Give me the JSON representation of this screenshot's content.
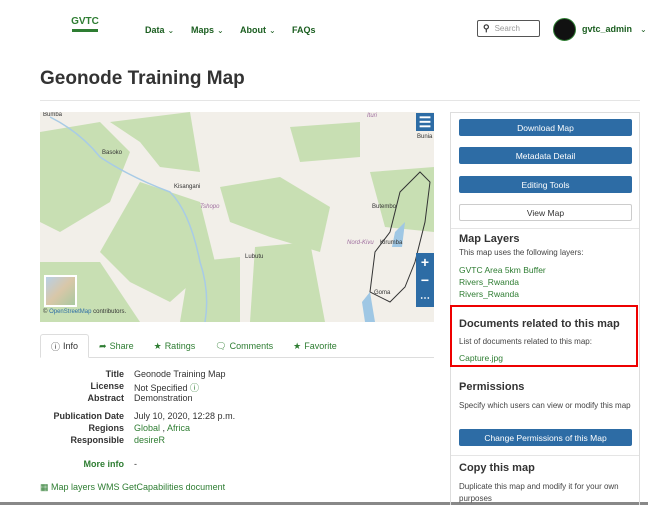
{
  "header": {
    "logo_text": "GVTC",
    "nav": [
      {
        "label": "Data"
      },
      {
        "label": "Maps"
      },
      {
        "label": "About"
      },
      {
        "label": "FAQs"
      }
    ],
    "search_placeholder": "Search",
    "user": "gvtc_admin"
  },
  "page_title": "Geonode Training Map",
  "map": {
    "labels": {
      "bumba": "Bumba",
      "basoko": "Basoko",
      "kisangani": "Kisangani",
      "tshopo": "Tshopo",
      "lubutu": "Lubutu",
      "ituri": "Ituri",
      "bunia": "Bunia",
      "butembo": "Butembo",
      "nordkivu": "Nord-Kivu",
      "kirumba": "Kirumba",
      "goma": "Goma"
    },
    "attribution_link": "OpenStreetMap",
    "attribution_rest": " contributors.",
    "attribution_prefix": "© "
  },
  "tabs": [
    {
      "label": "Info"
    },
    {
      "label": "Share"
    },
    {
      "label": "Ratings"
    },
    {
      "label": "Comments"
    },
    {
      "label": "Favorite"
    }
  ],
  "info": {
    "title_k": "Title",
    "title_v": "Geonode Training Map",
    "license_k": "License",
    "license_v": "Not Specified",
    "abstract_k": "Abstract",
    "abstract_v": "Demonstration",
    "pub_k": "Publication Date",
    "pub_v": "July 10, 2020, 12:28 p.m.",
    "regions_k": "Regions",
    "region1": "Global",
    "region_sep": " , ",
    "region2": "Africa",
    "resp_k": "Responsible",
    "resp_v": "desireR",
    "more_k": "More info",
    "more_v": "-",
    "wms_link": "Map layers WMS GetCapabilities document"
  },
  "sidebar": {
    "download": "Download Map",
    "metadata": "Metadata Detail",
    "editing": "Editing Tools",
    "view": "View Map",
    "layers_h": "Map Layers",
    "layers_p": "This map uses the following layers:",
    "layers": [
      "GVTC Area 5km Buffer",
      "Rivers_Rwanda",
      "Rivers_Rwanda"
    ],
    "docs_h": "Documents related to this map",
    "docs_p": "List of documents related to this map:",
    "doc": "Capture.jpg",
    "perm_h": "Permissions",
    "perm_p": "Specify which users can view or modify this map",
    "perm_btn": "Change Permissions of this Map",
    "copy_h": "Copy this map",
    "copy_p": "Duplicate this map and modify it for your own purposes"
  }
}
